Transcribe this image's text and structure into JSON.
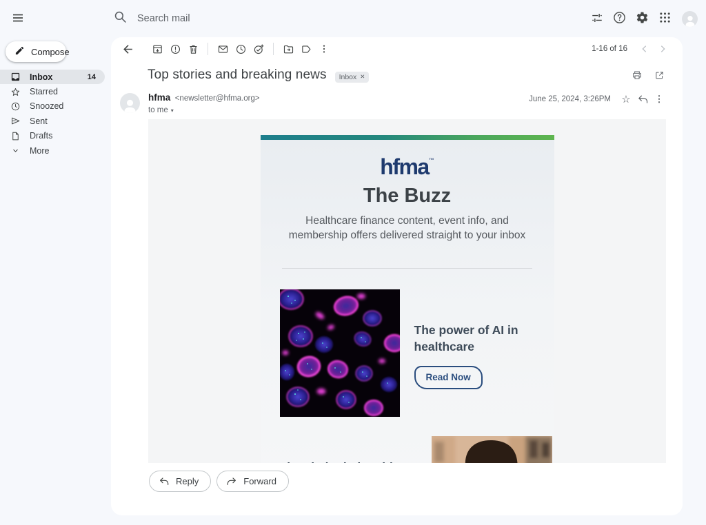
{
  "topbar": {
    "search_placeholder": "Search mail"
  },
  "sidebar": {
    "compose_label": "Compose",
    "items": [
      {
        "label": "Inbox",
        "icon": "inbox-icon",
        "count": "14",
        "selected": true
      },
      {
        "label": "Starred",
        "icon": "star-icon"
      },
      {
        "label": "Snoozed",
        "icon": "clock-icon"
      },
      {
        "label": "Sent",
        "icon": "send-icon"
      },
      {
        "label": "Drafts",
        "icon": "draft-icon"
      },
      {
        "label": "More",
        "icon": "chevron-down-icon"
      }
    ]
  },
  "toolbar": {
    "pagination": "1-16 of 16"
  },
  "email": {
    "subject": "Top stories and breaking news",
    "label_chip": "Inbox",
    "sender_name": "hfma",
    "sender_address": "<newsletter@hfma.org>",
    "recipient": "to me",
    "date": "June 25, 2024, 3:26PM"
  },
  "newsletter": {
    "logo_text": "hfma",
    "logo_mark": "™",
    "title": "The Buzz",
    "subtitle": "Healthcare finance content, event info, and membership offers delivered straight to your inbox",
    "articles": [
      {
        "title": "The power of AI in healthcare",
        "cta": "Read Now",
        "image": "microscopy-cells"
      },
      {
        "title": "The vital relationship between MDs and clinical",
        "image": "doctor-portrait"
      }
    ]
  },
  "actions": {
    "reply_label": "Reply",
    "forward_label": "Forward"
  },
  "icons": {
    "gear": "⚙",
    "star": "☆",
    "more_vert": "⋮",
    "close": "✕",
    "dropdown": "▾"
  },
  "colors": {
    "page_bg": "#f6f8fc",
    "gradient_left": "#1d7e8c",
    "gradient_right": "#5eb54f",
    "brand_navy": "#1e3a6e",
    "cta_navy": "#2a4d7e"
  }
}
